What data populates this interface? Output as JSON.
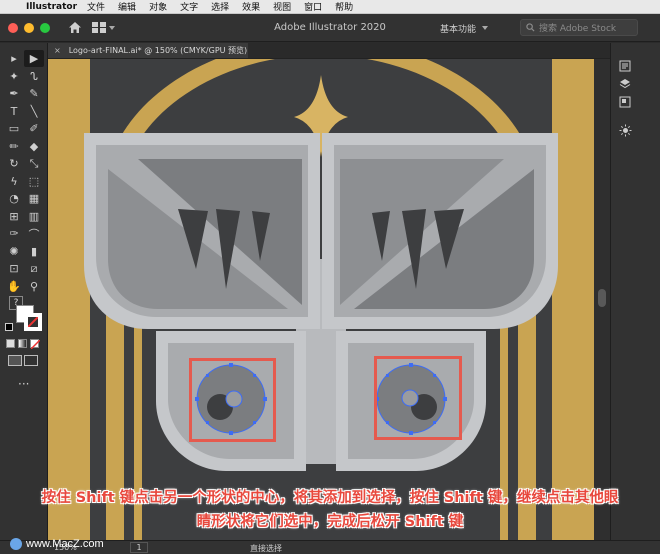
{
  "menubar": {
    "app_name": "Illustrator",
    "items": [
      "文件",
      "编辑",
      "对象",
      "文字",
      "选择",
      "效果",
      "视图",
      "窗口",
      "帮助"
    ]
  },
  "appbar": {
    "title": "Adobe Illustrator 2020",
    "workspace": "基本功能",
    "search_placeholder": "搜索 Adobe Stock"
  },
  "document": {
    "tab_label": "Logo-art-FINAL.ai* @ 150% (CMYK/GPU 预览)",
    "close_glyph": "×"
  },
  "status": {
    "zoom": "150%",
    "page": "1",
    "tool_name": "直接选择"
  },
  "tools": [
    {
      "name": "selection-tool",
      "glyph": "▸"
    },
    {
      "name": "direct-selection-tool",
      "glyph": "▶"
    },
    {
      "name": "magic-wand-tool",
      "glyph": "✦"
    },
    {
      "name": "lasso-tool",
      "glyph": "ᔐ"
    },
    {
      "name": "pen-tool",
      "glyph": "✒"
    },
    {
      "name": "curvature-tool",
      "glyph": "✎"
    },
    {
      "name": "type-tool",
      "glyph": "T"
    },
    {
      "name": "line-tool",
      "glyph": "╲"
    },
    {
      "name": "rectangle-tool",
      "glyph": "▭"
    },
    {
      "name": "paintbrush-tool",
      "glyph": "✐"
    },
    {
      "name": "shaper-tool",
      "glyph": "✏"
    },
    {
      "name": "eraser-tool",
      "glyph": "◆"
    },
    {
      "name": "rotate-tool",
      "glyph": "↻"
    },
    {
      "name": "scale-tool",
      "glyph": "⤡"
    },
    {
      "name": "warp-tool",
      "glyph": "ϟ"
    },
    {
      "name": "free-transform-tool",
      "glyph": "⬚"
    },
    {
      "name": "shape-builder-tool",
      "glyph": "◔"
    },
    {
      "name": "perspective-grid-tool",
      "glyph": "▦"
    },
    {
      "name": "mesh-tool",
      "glyph": "⊞"
    },
    {
      "name": "gradient-tool",
      "glyph": "▥"
    },
    {
      "name": "eyedropper-tool",
      "glyph": "✑"
    },
    {
      "name": "blend-tool",
      "glyph": "⌒"
    },
    {
      "name": "symbol-sprayer-tool",
      "glyph": "✺"
    },
    {
      "name": "column-graph-tool",
      "glyph": "▮"
    },
    {
      "name": "artboard-tool",
      "glyph": "⊡"
    },
    {
      "name": "slice-tool",
      "glyph": "⧄"
    },
    {
      "name": "hand-tool",
      "glyph": "✋"
    },
    {
      "name": "zoom-tool",
      "glyph": "⚲"
    }
  ],
  "colors": {
    "gold": "#c9a452",
    "background_dark": "#3d3e40",
    "highlight_red": "#e55a4e",
    "caption_red": "#e8483d",
    "selection_blue": "#3d6cf5"
  },
  "caption": {
    "line1": "按住 Shift 键点击另一个形状的中心，将其添加到选择，按住 Shift 键，继续点击其他眼",
    "line2": "睛形状将它们选中，完成后松开 Shift 键"
  },
  "watermark": {
    "text": "www.MacZ.com"
  }
}
